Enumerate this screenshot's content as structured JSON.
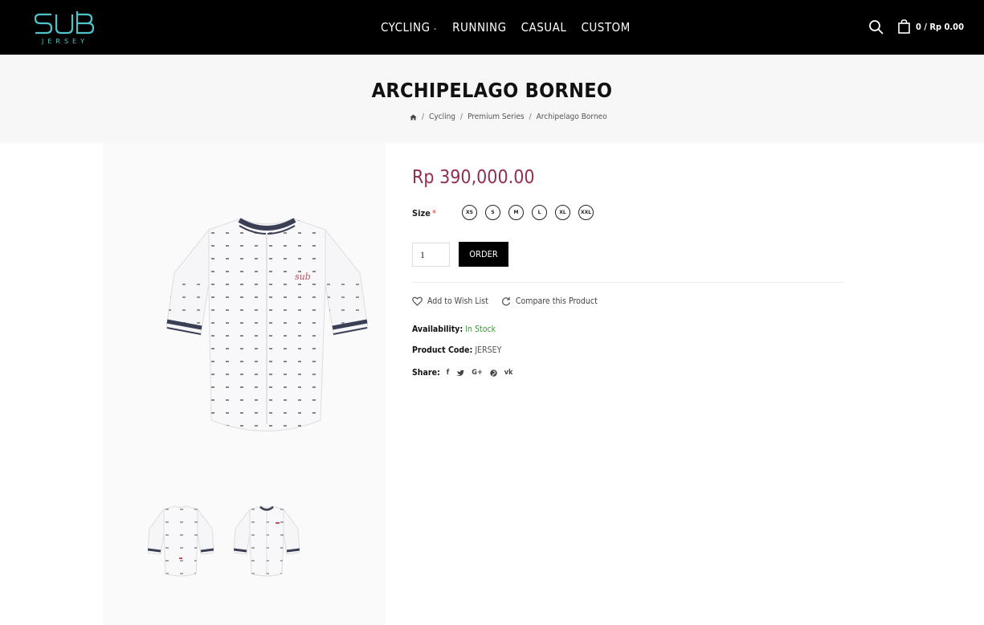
{
  "brand": {
    "logo_top": "SUB",
    "logo_bottom": "JERSEY",
    "accent": "#4fc3c8"
  },
  "nav": {
    "items": [
      {
        "label": "CYCLING",
        "has_dropdown": true
      },
      {
        "label": "RUNNING"
      },
      {
        "label": "CASUAL"
      },
      {
        "label": "CUSTOM"
      }
    ]
  },
  "header": {
    "cart_text": "0 / Rp 0.00"
  },
  "page": {
    "title": "ARCHIPELAGO BORNEO"
  },
  "breadcrumb": {
    "home_icon": "home-icon",
    "items": [
      "Cycling",
      "Premium Series",
      "Archipelago Borneo"
    ],
    "separator": "/"
  },
  "product": {
    "price": "Rp 390,000.00",
    "price_color": "#8f2f53",
    "size_label": "Size",
    "required_mark": "*",
    "sizes": [
      "XS",
      "S",
      "M",
      "L",
      "XL",
      "XXL"
    ],
    "quantity": "1",
    "order_label": "ORDER",
    "wishlist_label": "Add to Wish List",
    "compare_label": "Compare this Product",
    "availability_label": "Availability:",
    "availability_value": "In Stock",
    "code_label": "Product Code:",
    "code_value": "JERSEY",
    "share_label": "Share:",
    "share_icons": [
      "facebook-icon",
      "twitter-icon",
      "google-plus-icon",
      "pinterest-icon",
      "vk-icon"
    ],
    "image_text": "sub"
  }
}
